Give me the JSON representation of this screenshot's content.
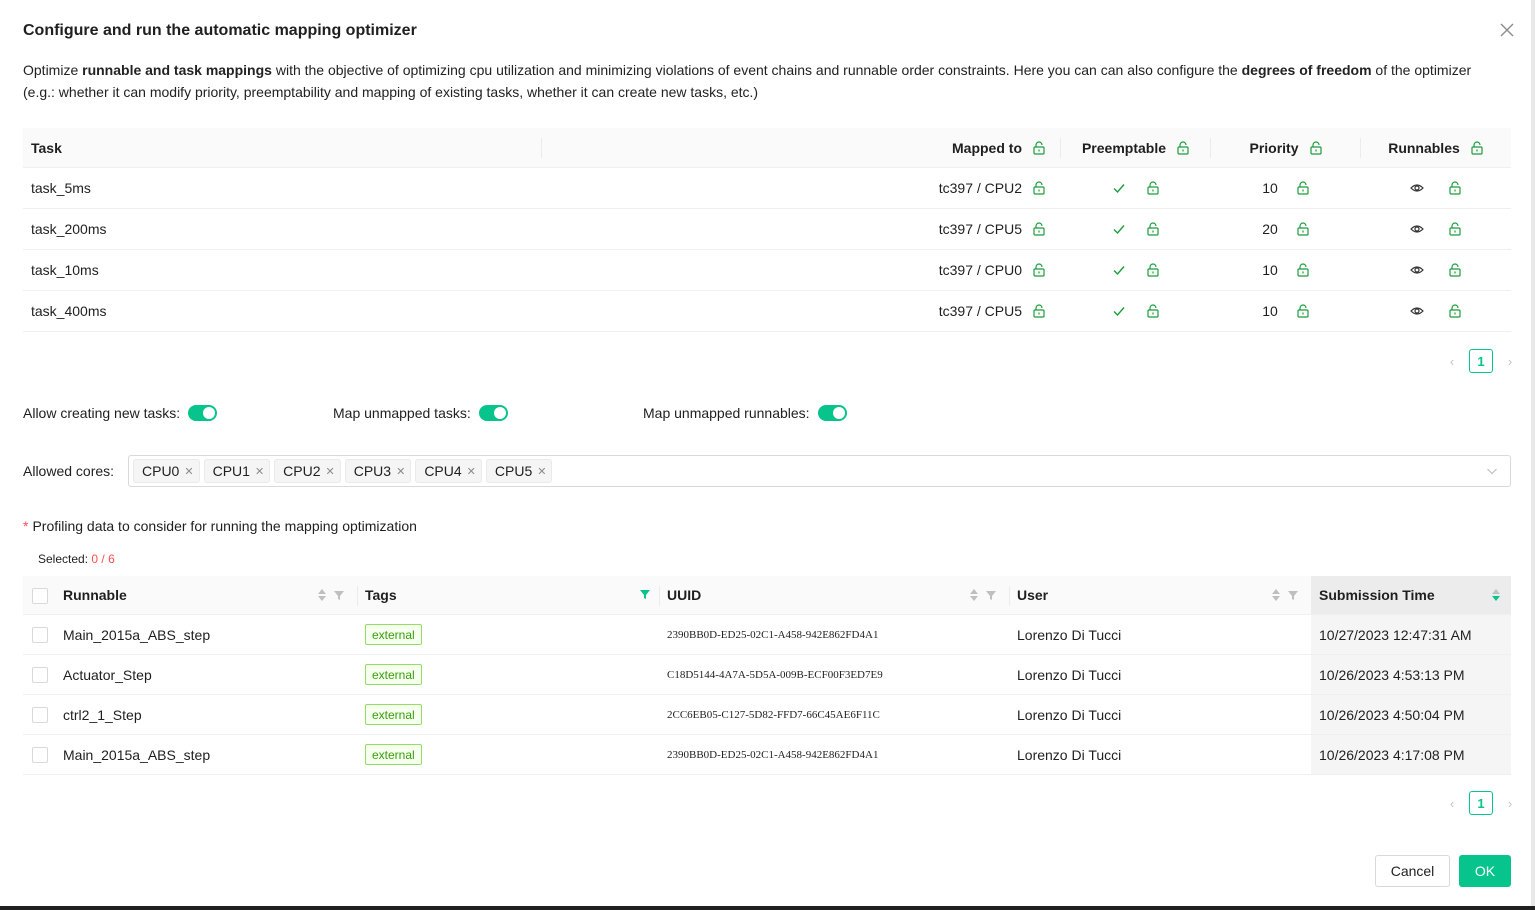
{
  "dialog": {
    "title": "Configure and run the automatic mapping optimizer",
    "desc_1": "Optimize ",
    "desc_b1": "runnable and task mappings",
    "desc_2": " with the objective of optimizing cpu utilization and minimizing violations of event chains and runnable order constraints. Here you can can also configure the ",
    "desc_b2": "degrees of freedom",
    "desc_3": " of the optimizer (e.g.: whether it can modify priority, preemptability and mapping of existing tasks, whether it can create new tasks, etc.)"
  },
  "task_table": {
    "headers": {
      "task": "Task",
      "mapped_to": "Mapped to",
      "preemptable": "Preemptable",
      "priority": "Priority",
      "runnables": "Runnables"
    },
    "rows": [
      {
        "task": "task_5ms",
        "mapped_to": "tc397 / CPU2",
        "priority": "10"
      },
      {
        "task": "task_200ms",
        "mapped_to": "tc397 / CPU5",
        "priority": "20"
      },
      {
        "task": "task_10ms",
        "mapped_to": "tc397 / CPU0",
        "priority": "10"
      },
      {
        "task": "task_400ms",
        "mapped_to": "tc397 / CPU5",
        "priority": "10"
      }
    ],
    "page": "1"
  },
  "toggles": {
    "allow_new_tasks": "Allow creating new tasks",
    "map_unmapped_tasks": "Map unmapped tasks",
    "map_unmapped_runnables": "Map unmapped runnables"
  },
  "cores": {
    "label": "Allowed cores",
    "items": [
      "CPU0",
      "CPU1",
      "CPU2",
      "CPU3",
      "CPU4",
      "CPU5"
    ]
  },
  "profiling": {
    "label": "Profiling data to consider for running the mapping optimization",
    "selected_label": "Selected:",
    "selected_count": "0 / 6",
    "headers": {
      "runnable": "Runnable",
      "tags": "Tags",
      "uuid": "UUID",
      "user": "User",
      "time": "Submission Time"
    },
    "rows": [
      {
        "runnable": "Main_2015a_ABS_step",
        "tag": "external",
        "uuid": "2390BB0D-ED25-02C1-A458-942E862FD4A1",
        "user": "Lorenzo Di Tucci",
        "time": "10/27/2023 12:47:31 AM"
      },
      {
        "runnable": "Actuator_Step",
        "tag": "external",
        "uuid": "C18D5144-4A7A-5D5A-009B-ECF00F3ED7E9",
        "user": "Lorenzo Di Tucci",
        "time": "10/26/2023 4:53:13 PM"
      },
      {
        "runnable": "ctrl2_1_Step",
        "tag": "external",
        "uuid": "2CC6EB05-C127-5D82-FFD7-66C45AE6F11C",
        "user": "Lorenzo Di Tucci",
        "time": "10/26/2023 4:50:04 PM"
      },
      {
        "runnable": "Main_2015a_ABS_step",
        "tag": "external",
        "uuid": "2390BB0D-ED25-02C1-A458-942E862FD4A1",
        "user": "Lorenzo Di Tucci",
        "time": "10/26/2023 4:17:08 PM"
      }
    ],
    "page": "1"
  },
  "footer": {
    "cancel": "Cancel",
    "ok": "OK"
  },
  "colors": {
    "accent": "#07c48c",
    "required": "#ff4d4f",
    "tag_text": "#389e0d"
  },
  "icons": [
    "close-icon",
    "lock-icon",
    "check-icon",
    "eye-icon",
    "sort-icon",
    "filter-icon",
    "chevron-down-icon",
    "chevron-left-icon",
    "chevron-right-icon"
  ]
}
